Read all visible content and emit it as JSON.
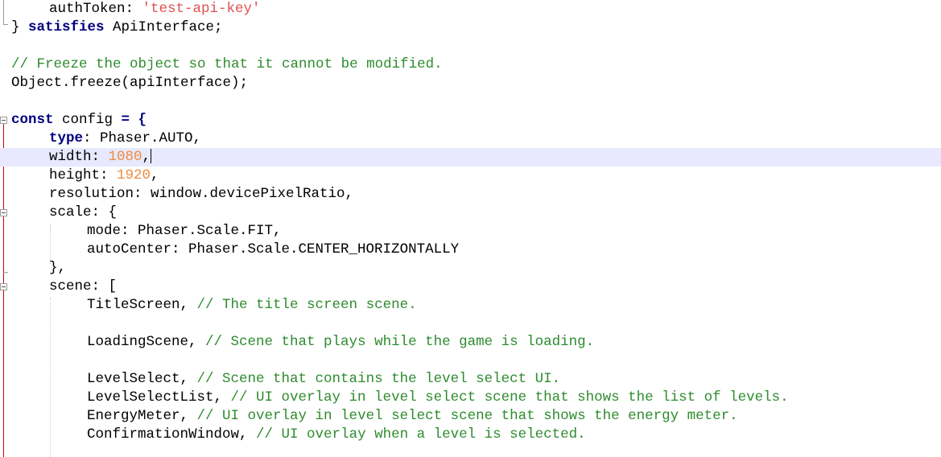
{
  "editor": {
    "current_line": "width",
    "lines": {
      "l1": {
        "prop": "authToken",
        "colon": ": ",
        "str": "'test-api-key'"
      },
      "l2": {
        "close": "} ",
        "kw": "satisfies",
        "rest": " ApiInterface;"
      },
      "l4": {
        "comment": "// Freeze the object so that it cannot be modified."
      },
      "l5": {
        "text": "Object.freeze",
        "paren": "(apiInterface);"
      },
      "l7": {
        "kw": "const",
        "rest": " config ",
        "op": "= {"
      },
      "l8": {
        "kw": "type",
        "rest": ": Phaser.AUTO,"
      },
      "l9": {
        "prop": "width: ",
        "num": "1080",
        "tail": ","
      },
      "l10": {
        "prop": "height: ",
        "num": "1920",
        "tail": ","
      },
      "l11": {
        "text": "resolution: window.devicePixelRatio,"
      },
      "l12": {
        "text": "scale: {"
      },
      "l13": {
        "text": "mode: Phaser.Scale.FIT,"
      },
      "l14": {
        "text": "autoCenter: Phaser.Scale.CENTER_HORIZONTALLY"
      },
      "l15": {
        "text": "},"
      },
      "l16": {
        "text": "scene: ["
      },
      "l17": {
        "code": "TitleScreen, ",
        "comment": "// The title screen scene."
      },
      "l19": {
        "code": "LoadingScene, ",
        "comment": "// Scene that plays while the game is loading."
      },
      "l21": {
        "code": "LevelSelect, ",
        "comment": "// Scene that contains the level select UI."
      },
      "l22": {
        "code": "LevelSelectList, ",
        "comment": "// UI overlay in level select scene that shows the list of levels."
      },
      "l23": {
        "code": "EnergyMeter, ",
        "comment": "// UI overlay in level select scene that shows the energy meter."
      },
      "l24": {
        "code": "ConfirmationWindow, ",
        "comment": "// UI overlay when a level is selected."
      }
    }
  },
  "colors": {
    "keyword": "#0000ff",
    "string": "#e05050",
    "number": "#f08c3c",
    "comment": "#2e8b2e",
    "current_line_bg": "#e8e8ff",
    "fold_marker": "#cc0000"
  }
}
